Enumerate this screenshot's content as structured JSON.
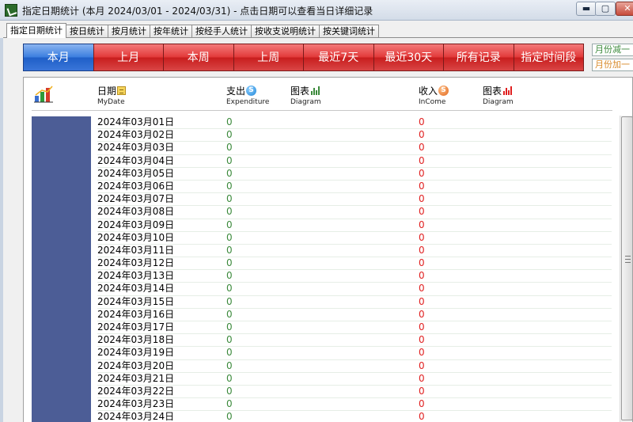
{
  "window": {
    "title": "指定日期统计 (本月 2024/03/01 - 2024/03/31) - 点击日期可以查看当日详细记录",
    "min_glyph": "▬",
    "max_glyph": "▢",
    "close_glyph": "✕"
  },
  "tabs": [
    {
      "label": "指定日期统计",
      "active": true
    },
    {
      "label": "按日统计"
    },
    {
      "label": "按月统计"
    },
    {
      "label": "按年统计"
    },
    {
      "label": "按经手人统计"
    },
    {
      "label": "按收支说明统计"
    },
    {
      "label": "按关键词统计"
    }
  ],
  "ranges": [
    {
      "label": "本月",
      "active": true
    },
    {
      "label": "上月"
    },
    {
      "label": "本周"
    },
    {
      "label": "上周"
    },
    {
      "label": "最近7天"
    },
    {
      "label": "最近30天"
    },
    {
      "label": "所有记录"
    },
    {
      "label": "指定时间段"
    }
  ],
  "month_nav": {
    "prev": "月份减一",
    "next": "月份加一"
  },
  "header": {
    "date": {
      "main": "日期",
      "sub": "MyDate"
    },
    "expenditure": {
      "main": "支出",
      "sub": "Expenditure",
      "icon_letter": "S"
    },
    "exp_diagram": {
      "main": "图表",
      "sub": "Diagram"
    },
    "income": {
      "main": "收入",
      "sub": "InCome",
      "icon_letter": "S"
    },
    "inc_diagram": {
      "main": "图表",
      "sub": "Diagram"
    }
  },
  "colors": {
    "expenditure": "#3c8a3c",
    "income": "#e02020",
    "side_block": "#4c5d96"
  },
  "rows": [
    {
      "date": "2024年03月01日",
      "expenditure": "0",
      "income": "0"
    },
    {
      "date": "2024年03月02日",
      "expenditure": "0",
      "income": "0"
    },
    {
      "date": "2024年03月03日",
      "expenditure": "0",
      "income": "0"
    },
    {
      "date": "2024年03月04日",
      "expenditure": "0",
      "income": "0"
    },
    {
      "date": "2024年03月05日",
      "expenditure": "0",
      "income": "0"
    },
    {
      "date": "2024年03月06日",
      "expenditure": "0",
      "income": "0"
    },
    {
      "date": "2024年03月07日",
      "expenditure": "0",
      "income": "0"
    },
    {
      "date": "2024年03月08日",
      "expenditure": "0",
      "income": "0"
    },
    {
      "date": "2024年03月09日",
      "expenditure": "0",
      "income": "0"
    },
    {
      "date": "2024年03月10日",
      "expenditure": "0",
      "income": "0"
    },
    {
      "date": "2024年03月11日",
      "expenditure": "0",
      "income": "0"
    },
    {
      "date": "2024年03月12日",
      "expenditure": "0",
      "income": "0"
    },
    {
      "date": "2024年03月13日",
      "expenditure": "0",
      "income": "0"
    },
    {
      "date": "2024年03月14日",
      "expenditure": "0",
      "income": "0"
    },
    {
      "date": "2024年03月15日",
      "expenditure": "0",
      "income": "0"
    },
    {
      "date": "2024年03月16日",
      "expenditure": "0",
      "income": "0"
    },
    {
      "date": "2024年03月17日",
      "expenditure": "0",
      "income": "0"
    },
    {
      "date": "2024年03月18日",
      "expenditure": "0",
      "income": "0"
    },
    {
      "date": "2024年03月19日",
      "expenditure": "0",
      "income": "0"
    },
    {
      "date": "2024年03月20日",
      "expenditure": "0",
      "income": "0"
    },
    {
      "date": "2024年03月21日",
      "expenditure": "0",
      "income": "0"
    },
    {
      "date": "2024年03月22日",
      "expenditure": "0",
      "income": "0"
    },
    {
      "date": "2024年03月23日",
      "expenditure": "0",
      "income": "0"
    },
    {
      "date": "2024年03月24日",
      "expenditure": "0",
      "income": "0"
    }
  ]
}
